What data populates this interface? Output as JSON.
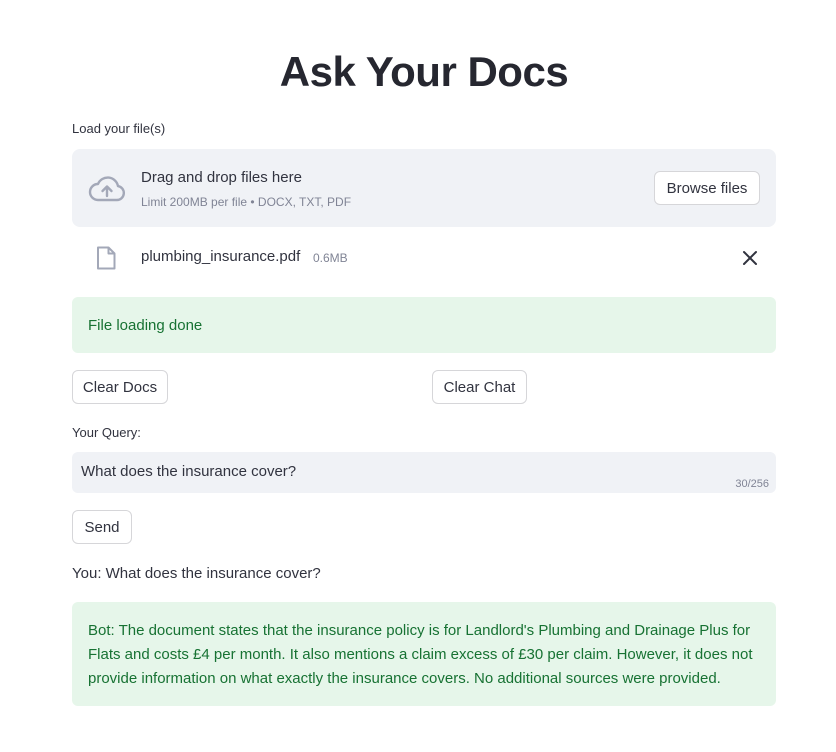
{
  "page": {
    "title": "Ask Your Docs"
  },
  "uploader": {
    "label": "Load your file(s)",
    "drop_title": "Drag and drop files here",
    "drop_limits": "Limit 200MB per file • DOCX, TXT, PDF",
    "browse_label": "Browse files",
    "files": [
      {
        "name": "plumbing_insurance.pdf",
        "size": "0.6MB"
      }
    ]
  },
  "status": {
    "message": "File loading done"
  },
  "actions": {
    "clear_docs": "Clear Docs",
    "clear_chat": "Clear Chat"
  },
  "query": {
    "label": "Your Query:",
    "value": "What does the insurance cover?",
    "char_count": "30/256",
    "send_label": "Send"
  },
  "chat": {
    "user_message": "You: What does the insurance cover?",
    "bot_message": "Bot: The document states that the insurance policy is for Landlord's Plumbing and Drainage Plus for Flats and costs £4 per month. It also mentions a claim excess of £30 per claim. However, it does not provide information on what exactly the insurance covers. No additional sources were provided."
  },
  "icons": {
    "upload": "cloud-upload-icon",
    "file": "file-icon",
    "close": "close-icon"
  },
  "colors": {
    "panel_bg": "#f0f2f6",
    "success_bg": "#e6f6ea",
    "success_text": "#177233",
    "icon": "#a3a8b8"
  }
}
